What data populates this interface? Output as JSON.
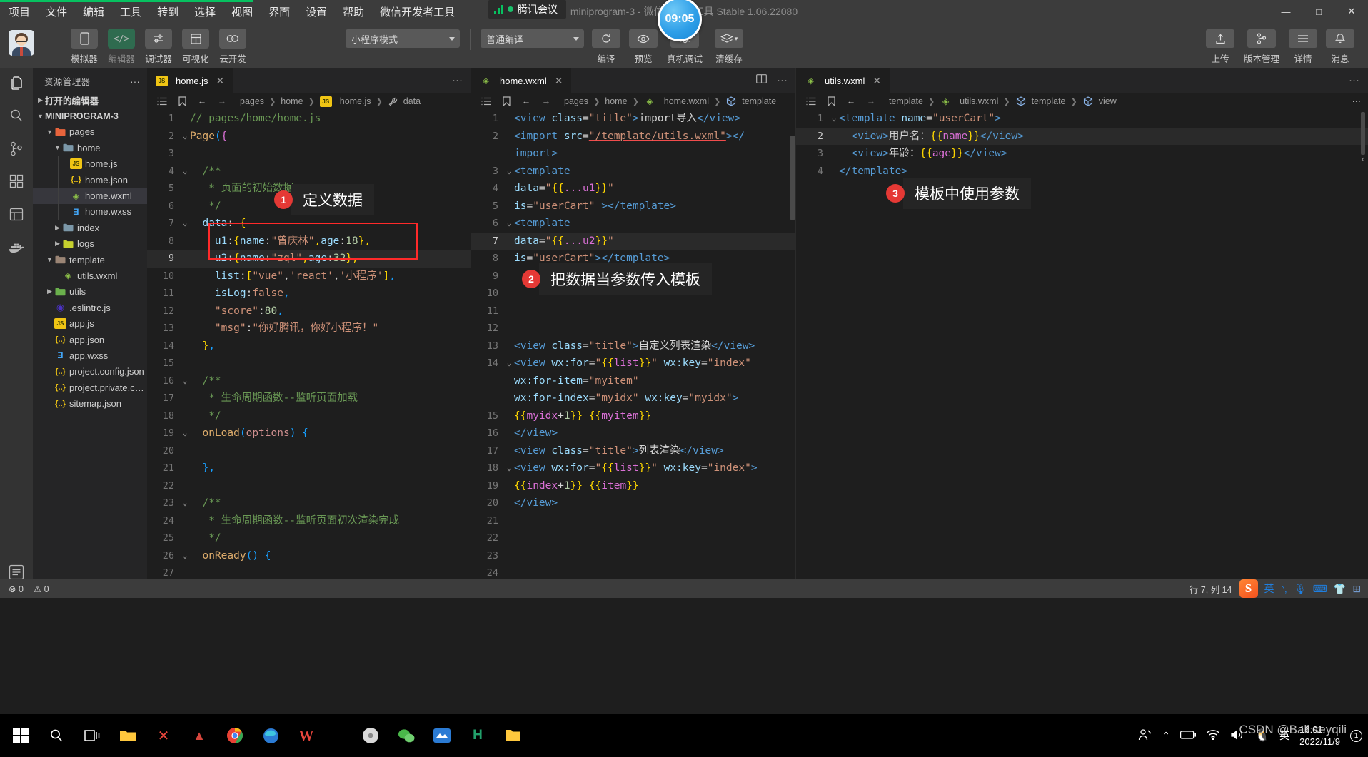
{
  "titlebar": {
    "menus": [
      "项目",
      "文件",
      "编辑",
      "工具",
      "转到",
      "选择",
      "视图",
      "界面",
      "设置",
      "帮助",
      "微信开发者工具"
    ],
    "title": "miniprogram-3 - 微信开发者工具 Stable 1.06.22080",
    "window_controls": {
      "minimize": "—",
      "maximize": "□",
      "close": "✕"
    }
  },
  "meeting_overlay": {
    "label": "腾讯会议",
    "timer": "09:05"
  },
  "toolbar": {
    "left_buttons": [
      {
        "label": "模拟器",
        "icon": "phone-icon"
      },
      {
        "label": "编辑器",
        "icon": "code-icon"
      },
      {
        "label": "调试器",
        "icon": "sliders-icon"
      },
      {
        "label": "可视化",
        "icon": "layout-icon"
      },
      {
        "label": "云开发",
        "icon": "cloud-icon"
      }
    ],
    "mode_select": "小程序模式",
    "compile_select": "普通编译",
    "action_buttons": [
      {
        "label": "编译",
        "icon": "refresh-icon"
      },
      {
        "label": "预览",
        "icon": "eye-icon"
      },
      {
        "label": "真机调试",
        "icon": "bug-icon"
      },
      {
        "label": "清缓存",
        "icon": "layers-icon"
      }
    ],
    "right_buttons": [
      {
        "label": "上传",
        "icon": "upload-icon"
      },
      {
        "label": "版本管理",
        "icon": "branch-icon"
      },
      {
        "label": "详情",
        "icon": "menu-icon"
      },
      {
        "label": "消息",
        "icon": "bell-icon"
      }
    ]
  },
  "activity_bar": {
    "items": [
      {
        "name": "explorer",
        "icon": "files-icon"
      },
      {
        "name": "search",
        "icon": "search-icon"
      },
      {
        "name": "source-control",
        "icon": "branch-icon"
      },
      {
        "name": "extensions",
        "icon": "extensions-icon"
      },
      {
        "name": "debug",
        "icon": "panel-icon"
      },
      {
        "name": "docker",
        "icon": "docker-icon"
      },
      {
        "name": "settings",
        "icon": "list-icon"
      }
    ]
  },
  "sidebar": {
    "title": "资源管理器",
    "open_editors": "打开的编辑器",
    "project_root": "MINIPROGRAM-3",
    "tree": [
      {
        "label": "pages",
        "indent": 1,
        "type": "folder",
        "color": "#e8643c",
        "expanded": true
      },
      {
        "label": "home",
        "indent": 2,
        "type": "folder",
        "color": "#7b97a8",
        "expanded": true
      },
      {
        "label": "home.js",
        "indent": 3,
        "type": "js"
      },
      {
        "label": "home.json",
        "indent": 3,
        "type": "json"
      },
      {
        "label": "home.wxml",
        "indent": 3,
        "type": "wxml",
        "selected": true
      },
      {
        "label": "home.wxss",
        "indent": 3,
        "type": "wxss"
      },
      {
        "label": "index",
        "indent": 2,
        "type": "folder",
        "color": "#7b97a8",
        "expanded": false
      },
      {
        "label": "logs",
        "indent": 2,
        "type": "folder",
        "color": "#c6d02e",
        "expanded": false
      },
      {
        "label": "template",
        "indent": 1,
        "type": "folder",
        "color": "#9b8575",
        "expanded": true
      },
      {
        "label": "utils.wxml",
        "indent": 2,
        "type": "wxml"
      },
      {
        "label": "utils",
        "indent": 1,
        "type": "folder",
        "color": "#6ab04c",
        "expanded": false
      },
      {
        "label": ".eslintrc.js",
        "indent": 1,
        "type": "eslint"
      },
      {
        "label": "app.js",
        "indent": 1,
        "type": "js"
      },
      {
        "label": "app.json",
        "indent": 1,
        "type": "json"
      },
      {
        "label": "app.wxss",
        "indent": 1,
        "type": "wxss"
      },
      {
        "label": "project.config.json",
        "indent": 1,
        "type": "json"
      },
      {
        "label": "project.private.config.json",
        "indent": 1,
        "type": "json"
      },
      {
        "label": "sitemap.json",
        "indent": 1,
        "type": "json"
      }
    ]
  },
  "panels": [
    {
      "tab": "home.js",
      "tab_icon": "js-icon",
      "breadcrumb": [
        "pages",
        "home",
        "home.js",
        "data"
      ],
      "breadcrumb_last_icon": "wrench-icon",
      "lines": [
        {
          "n": 1,
          "fold": "",
          "html": "<span class='c-com'>// pages/home/home.js</span>"
        },
        {
          "n": 2,
          "fold": "v",
          "html": "<span class='c-kw'>Page</span><span class='c-brk3'>(</span><span class='c-brk2'>{</span>"
        },
        {
          "n": 3,
          "fold": "",
          "html": ""
        },
        {
          "n": 4,
          "fold": "v",
          "html": "  <span class='c-com'>/**</span>"
        },
        {
          "n": 5,
          "fold": "",
          "html": "   <span class='c-com'>* 页面的初始数据</span>"
        },
        {
          "n": 6,
          "fold": "",
          "html": "   <span class='c-com'>*/</span>"
        },
        {
          "n": 7,
          "fold": "v",
          "html": "  <span class='c-key'>data</span><span class='c-op'>: </span><span class='c-brk1'>{</span>"
        },
        {
          "n": 8,
          "fold": "",
          "html": "    <span class='c-key'>u1</span><span class='c-op'>:</span><span class='c-brk1'>{</span><span class='c-key'>name</span><span class='c-op'>:</span><span class='c-str'>\"曾庆林\"</span><span class='c-brk1'>,</span><span class='c-key'>age</span><span class='c-op'>:</span><span class='c-num'>18</span><span class='c-brk1'>}</span><span class='c-brk1'>,</span>"
        },
        {
          "n": 9,
          "fold": "",
          "html": "    <span class='c-key'>u2</span><span class='c-op'>:</span><span class='c-brk1'>{</span><span class='c-key'>name</span><span class='c-op'>:</span><span class='c-str'>\"zql\"</span><span class='c-brk1'>,</span><span class='c-key'>age</span><span class='c-op'>:</span><span class='c-num'>32</span><span class='c-brk1'>}</span><span class='c-brk1'>,</span>",
          "current": true
        },
        {
          "n": 10,
          "fold": "",
          "html": "    <span class='c-key'>list</span><span class='c-op'>:</span><span class='c-brk1'>[</span><span class='c-str'>\"vue\"</span><span class='c-op'>,</span><span class='c-str'>'react'</span><span class='c-op'>,</span><span class='c-str'>'小程序'</span><span class='c-brk1'>]</span><span class='c-brk3'>,</span>"
        },
        {
          "n": 11,
          "fold": "",
          "html": "    <span class='c-key'>isLog</span><span class='c-op'>:</span><span class='c-str'>false</span><span class='c-brk3'>,</span>"
        },
        {
          "n": 12,
          "fold": "",
          "html": "    <span class='c-str'>\"score\"</span><span class='c-op'>:</span><span class='c-num'>80</span><span class='c-brk3'>,</span>"
        },
        {
          "n": 13,
          "fold": "",
          "html": "    <span class='c-str'>\"msg\"</span><span class='c-op'>:</span><span class='c-str'>\"你好腾讯，你好小程序！\"</span>"
        },
        {
          "n": 14,
          "fold": "",
          "html": "  <span class='c-brk1'>}</span><span class='c-brk3'>,</span>"
        },
        {
          "n": 15,
          "fold": "",
          "html": ""
        },
        {
          "n": 16,
          "fold": "v",
          "html": "  <span class='c-com'>/**</span>"
        },
        {
          "n": 17,
          "fold": "",
          "html": "   <span class='c-com'>* 生命周期函数--监听页面加载</span>"
        },
        {
          "n": 18,
          "fold": "",
          "html": "   <span class='c-com'>*/</span>"
        },
        {
          "n": 19,
          "fold": "v",
          "html": "  <span class='c-kw'>onLoad</span><span class='c-brk3'>(</span><span class='c-par'>options</span><span class='c-brk3'>)</span> <span class='c-brk3'>{</span>"
        },
        {
          "n": 20,
          "fold": "",
          "html": ""
        },
        {
          "n": 21,
          "fold": "",
          "html": "  <span class='c-brk3'>}</span><span class='c-brk3'>,</span>"
        },
        {
          "n": 22,
          "fold": "",
          "html": ""
        },
        {
          "n": 23,
          "fold": "v",
          "html": "  <span class='c-com'>/**</span>"
        },
        {
          "n": 24,
          "fold": "",
          "html": "   <span class='c-com'>* 生命周期函数--监听页面初次渲染完成</span>"
        },
        {
          "n": 25,
          "fold": "",
          "html": "   <span class='c-com'>*/</span>"
        },
        {
          "n": 26,
          "fold": "v",
          "html": "  <span class='c-kw'>onReady</span><span class='c-brk3'>(</span><span class='c-brk3'>)</span> <span class='c-brk3'>{</span>"
        },
        {
          "n": 27,
          "fold": "",
          "html": ""
        }
      ]
    },
    {
      "tab": "home.wxml",
      "tab_icon": "wxml-icon",
      "breadcrumb": [
        "pages",
        "home",
        "home.wxml",
        "template"
      ],
      "lines": [
        {
          "n": 1,
          "fold": "",
          "html": "<span class='c-tag'>&lt;view </span><span class='c-attr'>class</span><span class='c-op'>=</span><span class='c-str'>\"title\"</span><span class='c-tag'>&gt;</span>import导入<span class='c-tag'>&lt;/view&gt;</span>"
        },
        {
          "n": 2,
          "fold": "",
          "html": "<span class='c-tag'>&lt;import </span><span class='c-attr'>src</span><span class='c-op'>=</span><span class='c-str underline-err'>\"/template/utils.wxml\"</span><span class='c-tag'>&gt;&lt;/</span>"
        },
        {
          "n": "",
          "fold": "",
          "html": "<span class='c-tag'>import&gt;</span>"
        },
        {
          "n": 3,
          "fold": "v",
          "html": "<span class='c-tag'>&lt;template</span>"
        },
        {
          "n": 4,
          "fold": "",
          "html": "<span class='c-attr'>data</span><span class='c-op'>=</span><span class='c-str'>\"</span><span class='c-brk1'>{{</span><span class='c-brk2'>...u1</span><span class='c-brk1'>}}</span><span class='c-str'>\"</span>"
        },
        {
          "n": 5,
          "fold": "",
          "html": "<span class='c-attr'>is</span><span class='c-op'>=</span><span class='c-str'>\"userCart\"</span> <span class='c-tag'>&gt;&lt;/template&gt;</span>"
        },
        {
          "n": 6,
          "fold": "v",
          "html": "<span class='c-tag'>&lt;template</span>"
        },
        {
          "n": 7,
          "fold": "",
          "html": "<span class='c-attr'>data</span><span class='c-op'>=</span><span class='c-str'>\"</span><span class='c-brk1'>{{</span><span class='c-brk2'>...u2</span><span class='c-brk1'>}}</span><span class='c-str'>\"</span>",
          "current": true
        },
        {
          "n": 8,
          "fold": "",
          "html": "<span class='c-attr'>is</span><span class='c-op'>=</span><span class='c-str'>\"userCart\"</span><span class='c-tag'>&gt;&lt;/template&gt;</span>"
        },
        {
          "n": 9,
          "fold": "",
          "html": ""
        },
        {
          "n": 10,
          "fold": "",
          "html": ""
        },
        {
          "n": 11,
          "fold": "",
          "html": ""
        },
        {
          "n": 12,
          "fold": "",
          "html": ""
        },
        {
          "n": 13,
          "fold": "",
          "html": "<span class='c-tag'>&lt;view </span><span class='c-attr'>class</span><span class='c-op'>=</span><span class='c-str'>\"title\"</span><span class='c-tag'>&gt;</span>自定义列表渲染<span class='c-tag'>&lt;/view&gt;</span>"
        },
        {
          "n": 14,
          "fold": "v",
          "html": "<span class='c-tag'>&lt;view </span><span class='c-attr'>wx:for</span><span class='c-op'>=</span><span class='c-str'>\"</span><span class='c-brk1'>{{</span><span class='c-brk2'>list</span><span class='c-brk1'>}}</span><span class='c-str'>\"</span> <span class='c-attr'>wx:key</span><span class='c-op'>=</span><span class='c-str'>\"index\"</span>"
        },
        {
          "n": "",
          "fold": "",
          "html": "<span class='c-attr'>wx:for-item</span><span class='c-op'>=</span><span class='c-str'>\"myitem\"</span>"
        },
        {
          "n": "",
          "fold": "",
          "html": "<span class='c-attr'>wx:for-index</span><span class='c-op'>=</span><span class='c-str'>\"myidx\"</span> <span class='c-attr'>wx:key</span><span class='c-op'>=</span><span class='c-str'>\"myidx\"</span><span class='c-tag'>&gt;</span>"
        },
        {
          "n": 15,
          "fold": "",
          "html": "<span class='c-brk1'>{{</span><span class='c-brk2'>myidx</span><span class='c-op'>+</span><span class='c-num'>1</span><span class='c-brk1'>}}</span> <span class='c-brk1'>{{</span><span class='c-brk2'>myitem</span><span class='c-brk1'>}}</span>"
        },
        {
          "n": 16,
          "fold": "",
          "html": "<span class='c-tag'>&lt;/view&gt;</span>"
        },
        {
          "n": 17,
          "fold": "",
          "html": "<span class='c-tag'>&lt;view </span><span class='c-attr'>class</span><span class='c-op'>=</span><span class='c-str'>\"title\"</span><span class='c-tag'>&gt;</span>列表渲染<span class='c-tag'>&lt;/view&gt;</span>"
        },
        {
          "n": 18,
          "fold": "v",
          "html": "<span class='c-tag'>&lt;view </span><span class='c-attr'>wx:for</span><span class='c-op'>=</span><span class='c-str'>\"</span><span class='c-brk1'>{{</span><span class='c-brk2'>list</span><span class='c-brk1'>}}</span><span class='c-str'>\"</span> <span class='c-attr'>wx:key</span><span class='c-op'>=</span><span class='c-str'>\"index\"</span><span class='c-tag'>&gt;</span>"
        },
        {
          "n": 19,
          "fold": "",
          "html": "<span class='c-brk1'>{{</span><span class='c-brk2'>index</span><span class='c-op'>+</span><span class='c-num'>1</span><span class='c-brk1'>}}</span> <span class='c-brk1'>{{</span><span class='c-brk2'>item</span><span class='c-brk1'>}}</span>"
        },
        {
          "n": 20,
          "fold": "",
          "html": "<span class='c-tag'>&lt;/view&gt;</span>"
        },
        {
          "n": 21,
          "fold": "",
          "html": ""
        },
        {
          "n": 22,
          "fold": "",
          "html": ""
        },
        {
          "n": 23,
          "fold": "",
          "html": ""
        },
        {
          "n": 24,
          "fold": "",
          "html": ""
        }
      ]
    },
    {
      "tab": "utils.wxml",
      "tab_icon": "wxml-icon",
      "breadcrumb": [
        "template",
        "utils.wxml",
        "template",
        "view"
      ],
      "lines": [
        {
          "n": 1,
          "fold": "v",
          "html": "<span class='c-tag'>&lt;template </span><span class='c-attr'>name</span><span class='c-op'>=</span><span class='c-str'>\"userCart\"</span><span class='c-tag'>&gt;</span>"
        },
        {
          "n": 2,
          "fold": "",
          "html": "  <span class='c-tag'>&lt;view&gt;</span>用户名：<span class='c-brk1'>{{</span><span class='c-brk2'>name</span><span class='c-brk1'>}}</span><span class='c-tag'>&lt;/view&gt;</span>",
          "current": true
        },
        {
          "n": 3,
          "fold": "",
          "html": "  <span class='c-tag'>&lt;view&gt;</span>年龄：<span class='c-brk1'>{{</span><span class='c-brk2'>age</span><span class='c-brk1'>}}</span><span class='c-tag'>&lt;/view&gt;</span>"
        },
        {
          "n": 4,
          "fold": "",
          "html": "<span class='c-tag'>&lt;/template&gt;</span>"
        }
      ]
    }
  ],
  "annotations": [
    {
      "num": "1",
      "text": "定义数据"
    },
    {
      "num": "2",
      "text": "把数据当参数传入模板"
    },
    {
      "num": "3",
      "text": "模板中使用参数"
    }
  ],
  "statusbar": {
    "errors": "0",
    "warnings": "0",
    "cursor": "行 7, 列 14",
    "ime_lang": "英"
  },
  "taskbar": {
    "clock_time": "16:01",
    "clock_date": "2022/11/9",
    "watermark": "CSDN @Ball seyqili",
    "ime_lang": "英"
  }
}
